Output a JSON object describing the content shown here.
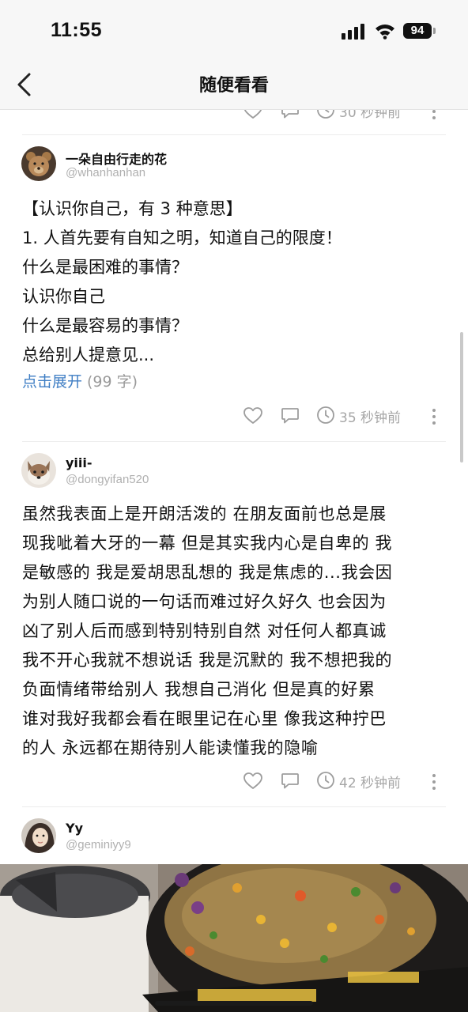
{
  "status_bar": {
    "time": "11:55",
    "battery": "94"
  },
  "nav": {
    "title": "随便看看"
  },
  "posts": [
    {
      "time": "30 秒钟前"
    },
    {
      "name": "一朵自由行走的花",
      "handle": "@whanhanhan",
      "body": "【认识你自己，有 3 种意思】\n1. 人首先要有自知之明，知道自己的限度！\n什么是最困难的事情？\n认识你自己\n什么是最容易的事情？\n总给别人提意见...",
      "expand_label": "点击展开",
      "char_count": "(99 字)",
      "time": "35 秒钟前"
    },
    {
      "name": "yiii-",
      "handle": "@dongyifan520",
      "body": "虽然我表面上是开朗活泼的 在朋友面前也总是展\n现我呲着大牙的一幕 但是其实我内心是自卑的 我\n是敏感的 我是爱胡思乱想的 我是焦虑的...我会因\n为别人随口说的一句话而难过好久好久 也会因为\n凶了别人后而感到特别特别自然 对任何人都真诚\n我不开心我就不想说话 我是沉默的 我不想把我的\n负面情绪带给别人 我想自己消化 但是真的好累\n谁对我好我都会看在眼里记在心里 像我这种拧巴\n的人 永远都在期待别人能读懂我的隐喻",
      "time": "42 秒钟前"
    },
    {
      "name": "Yy",
      "handle": "@geminiyy9"
    }
  ],
  "icons": {
    "like": "heart-icon",
    "comment": "comment-icon",
    "time": "clock-icon",
    "more": "more-vertical-icon",
    "back": "chevron-left-icon"
  }
}
